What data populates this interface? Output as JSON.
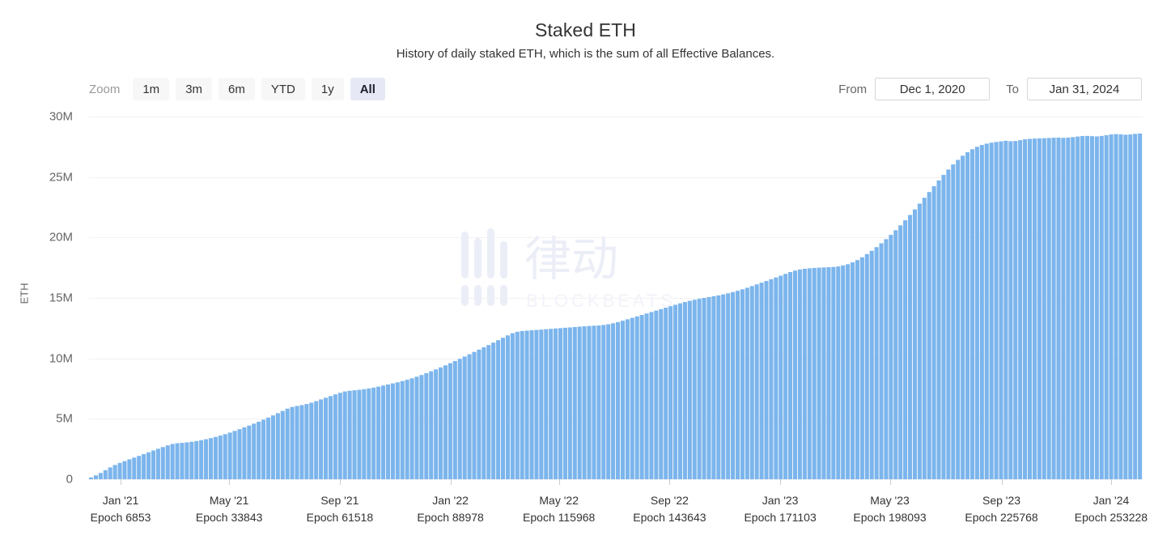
{
  "header": {
    "title": "Staked ETH",
    "subtitle": "History of daily staked ETH, which is the sum of all Effective Balances."
  },
  "range_selector": {
    "label": "Zoom",
    "buttons": [
      {
        "label": "1m",
        "selected": false
      },
      {
        "label": "3m",
        "selected": false
      },
      {
        "label": "6m",
        "selected": false
      },
      {
        "label": "YTD",
        "selected": false
      },
      {
        "label": "1y",
        "selected": false
      },
      {
        "label": "All",
        "selected": true
      }
    ]
  },
  "date_range": {
    "from_label": "From",
    "from_value": "Dec 1, 2020",
    "to_label": "To",
    "to_value": "Jan 31, 2024"
  },
  "watermark": {
    "cjk_text": "律动",
    "latin_text": "BLOCKBEATS",
    "color": "#eceef7"
  },
  "colors": {
    "bar": "#7cb5ec",
    "gridline": "#f2f2f2",
    "axis_text": "#666666",
    "selected_button_bg": "#e6e9f5",
    "button_bg": "#f7f7f7"
  },
  "chart_data": {
    "type": "bar",
    "title": "Staked ETH",
    "subtitle": "History of daily staked ETH, which is the sum of all Effective Balances.",
    "xlabel": "",
    "ylabel": "ETH",
    "ylim": [
      0,
      30000000
    ],
    "ytick_labels": [
      "0",
      "5M",
      "10M",
      "15M",
      "20M",
      "25M",
      "30M"
    ],
    "ytick_values": [
      0,
      5000000,
      10000000,
      15000000,
      20000000,
      25000000,
      30000000
    ],
    "grid": true,
    "legend": "none",
    "x_range": [
      "Dec 1, 2020",
      "Jan 31, 2024"
    ],
    "xticks": [
      {
        "month": "Jan '21",
        "epoch": "Epoch 6853",
        "pos": 0.03
      },
      {
        "month": "May '21",
        "epoch": "Epoch 33843",
        "pos": 0.133
      },
      {
        "month": "Sep '21",
        "epoch": "Epoch 61518",
        "pos": 0.238
      },
      {
        "month": "Jan '22",
        "epoch": "Epoch 88978",
        "pos": 0.343
      },
      {
        "month": "May '22",
        "epoch": "Epoch 115968",
        "pos": 0.446
      },
      {
        "month": "Sep '22",
        "epoch": "Epoch 143643",
        "pos": 0.551
      },
      {
        "month": "Jan '23",
        "epoch": "Epoch 171103",
        "pos": 0.656
      },
      {
        "month": "May '23",
        "epoch": "Epoch 198093",
        "pos": 0.76
      },
      {
        "month": "Sep '23",
        "epoch": "Epoch 225768",
        "pos": 0.866
      },
      {
        "month": "Jan '24",
        "epoch": "Epoch 253228",
        "pos": 0.97
      }
    ],
    "series": [
      {
        "name": "Staked ETH",
        "color": "#7cb5ec",
        "unit": "ETH",
        "values": [
          150000,
          320000,
          520000,
          750000,
          980000,
          1180000,
          1350000,
          1500000,
          1650000,
          1790000,
          1930000,
          2080000,
          2230000,
          2380000,
          2520000,
          2660000,
          2800000,
          2920000,
          2980000,
          3010000,
          3050000,
          3100000,
          3160000,
          3230000,
          3310000,
          3400000,
          3500000,
          3610000,
          3730000,
          3860000,
          4000000,
          4140000,
          4290000,
          4440000,
          4600000,
          4760000,
          4930000,
          5100000,
          5280000,
          5460000,
          5650000,
          5840000,
          5980000,
          6060000,
          6130000,
          6220000,
          6330000,
          6460000,
          6600000,
          6740000,
          6880000,
          7020000,
          7150000,
          7260000,
          7320000,
          7360000,
          7400000,
          7450000,
          7510000,
          7580000,
          7660000,
          7750000,
          7840000,
          7930000,
          8020000,
          8120000,
          8230000,
          8350000,
          8480000,
          8620000,
          8770000,
          8930000,
          9090000,
          9250000,
          9420000,
          9600000,
          9780000,
          9960000,
          10150000,
          10340000,
          10530000,
          10720000,
          10910000,
          11100000,
          11300000,
          11500000,
          11700000,
          11900000,
          12080000,
          12200000,
          12260000,
          12290000,
          12320000,
          12350000,
          12380000,
          12410000,
          12440000,
          12470000,
          12500000,
          12530000,
          12560000,
          12590000,
          12620000,
          12650000,
          12680000,
          12700000,
          12720000,
          12760000,
          12820000,
          12900000,
          13000000,
          13110000,
          13230000,
          13350000,
          13470000,
          13590000,
          13710000,
          13830000,
          13950000,
          14070000,
          14190000,
          14310000,
          14430000,
          14550000,
          14660000,
          14760000,
          14850000,
          14930000,
          15000000,
          15070000,
          15140000,
          15210000,
          15290000,
          15380000,
          15480000,
          15590000,
          15710000,
          15840000,
          15980000,
          16120000,
          16260000,
          16400000,
          16540000,
          16690000,
          16840000,
          16990000,
          17140000,
          17260000,
          17350000,
          17410000,
          17450000,
          17480000,
          17500000,
          17520000,
          17540000,
          17560000,
          17600000,
          17680000,
          17790000,
          17940000,
          18130000,
          18360000,
          18620000,
          18900000,
          19200000,
          19520000,
          19860000,
          20220000,
          20600000,
          21000000,
          21420000,
          21860000,
          22320000,
          22800000,
          23280000,
          23760000,
          24240000,
          24720000,
          25180000,
          25620000,
          26040000,
          26420000,
          26760000,
          27050000,
          27300000,
          27500000,
          27650000,
          27760000,
          27840000,
          27900000,
          27950000,
          28000000,
          27960000,
          27980000,
          28050000,
          28120000,
          28160000,
          28180000,
          28200000,
          28210000,
          28230000,
          28250000,
          28260000,
          28240000,
          28260000,
          28300000,
          28350000,
          28390000,
          28400000,
          28380000,
          28360000,
          28400000,
          28460000,
          28520000,
          28550000,
          28530000,
          28500000,
          28520000,
          28570000,
          28600000
        ]
      }
    ]
  }
}
